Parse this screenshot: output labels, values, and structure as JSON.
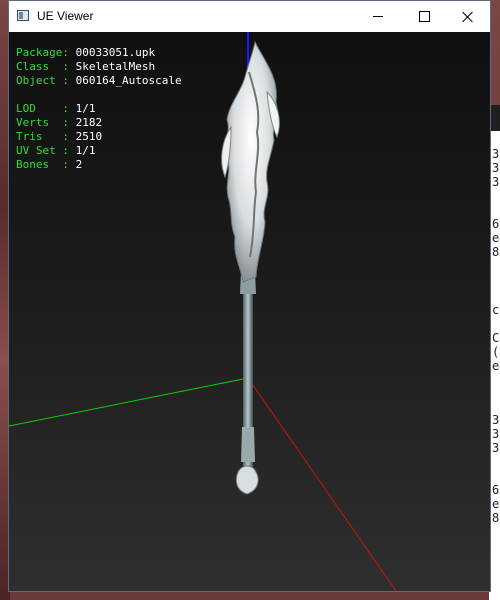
{
  "window": {
    "title": "UE Viewer",
    "controls": [
      "minimize",
      "maximize",
      "close"
    ]
  },
  "info": {
    "package": {
      "label": "Package: ",
      "value": "00033051.upk"
    },
    "class": {
      "label": "Class  : ",
      "value": "SkeletalMesh"
    },
    "object": {
      "label": "Object : ",
      "value": "060164_Autoscale"
    },
    "lod": {
      "label": "LOD    : ",
      "value": "1/1"
    },
    "verts": {
      "label": "Verts  : ",
      "value": "2182"
    },
    "tris": {
      "label": "Tris   : ",
      "value": "2510"
    },
    "uvset": {
      "label": "UV Set : ",
      "value": "1/1"
    },
    "bones": {
      "label": "Bones  : ",
      "value": "2"
    }
  },
  "axes": {
    "x_color": "#cc1111",
    "y_color": "#11cc11",
    "z_color": "#1a1aff"
  },
  "background_window": {
    "chars": [
      "3",
      "3",
      "3",
      "6",
      "e",
      "8",
      "c",
      "C",
      "(",
      "e",
      "3",
      "3",
      "3",
      "6",
      "e",
      "8"
    ]
  },
  "colors": {
    "label_green": "#33dd33",
    "value_white": "#ffffff"
  }
}
